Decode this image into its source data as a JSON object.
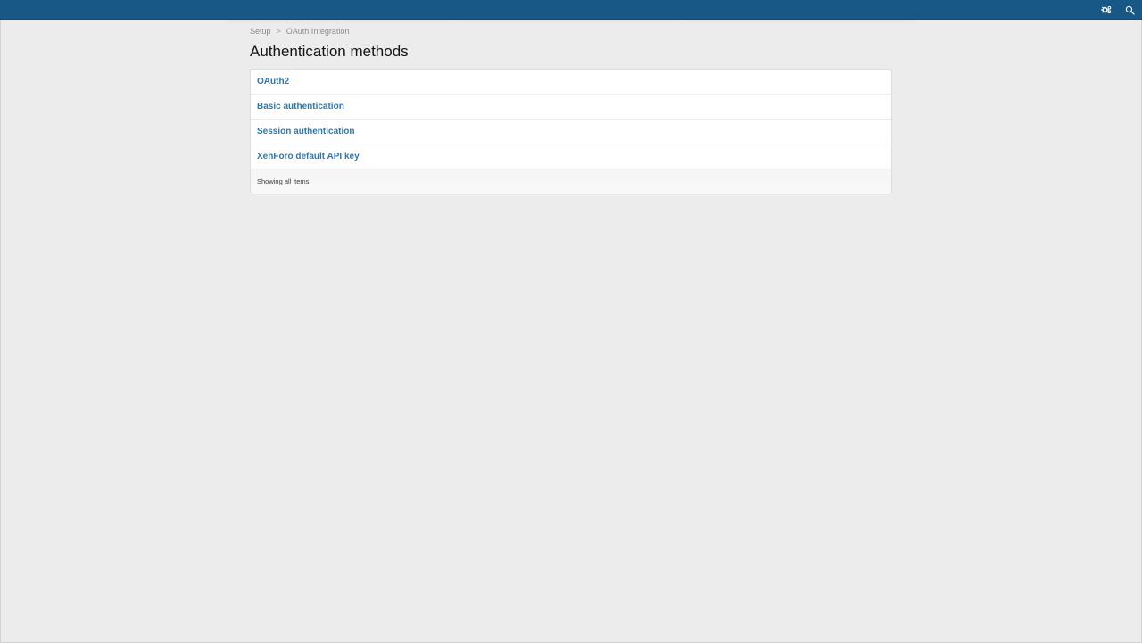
{
  "topbar": {
    "icons": [
      "cog-icon",
      "search-icon"
    ]
  },
  "breadcrumb": {
    "items": [
      "Setup",
      "OAuth Integration"
    ],
    "separator": ">"
  },
  "page": {
    "title": "Authentication methods"
  },
  "methods": {
    "items": [
      {
        "label": "OAuth2"
      },
      {
        "label": "Basic authentication"
      },
      {
        "label": "Session authentication"
      },
      {
        "label": "XenForo default API key"
      }
    ],
    "footer": "Showing all items"
  },
  "colors": {
    "topbar": "#185886",
    "link": "#2b78b5",
    "background": "#ececec"
  }
}
